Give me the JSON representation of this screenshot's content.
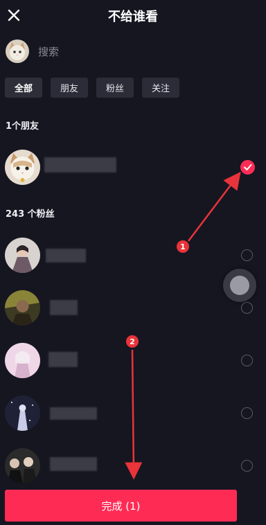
{
  "header": {
    "title": "不给谁看",
    "close_icon": "close-icon"
  },
  "search": {
    "placeholder": "搜索"
  },
  "tabs": [
    {
      "label": "全部",
      "selected": true
    },
    {
      "label": "朋友",
      "selected": false
    },
    {
      "label": "粉丝",
      "selected": false
    },
    {
      "label": "关注",
      "selected": false
    }
  ],
  "sections": {
    "friends_label": "1个朋友",
    "fans_label": "243 个粉丝"
  },
  "contacts": [
    {
      "group": "friend",
      "selected": true
    },
    {
      "group": "fan",
      "selected": false
    },
    {
      "group": "fan",
      "selected": false
    },
    {
      "group": "fan",
      "selected": false
    },
    {
      "group": "fan",
      "selected": false
    },
    {
      "group": "fan",
      "selected": false
    }
  ],
  "footer": {
    "done_label": "完成 (1)"
  },
  "annotations": {
    "badge1": "1",
    "badge2": "2"
  },
  "colors": {
    "accent": "#fe2c55",
    "background": "#161621",
    "chip": "#2c2c38"
  }
}
